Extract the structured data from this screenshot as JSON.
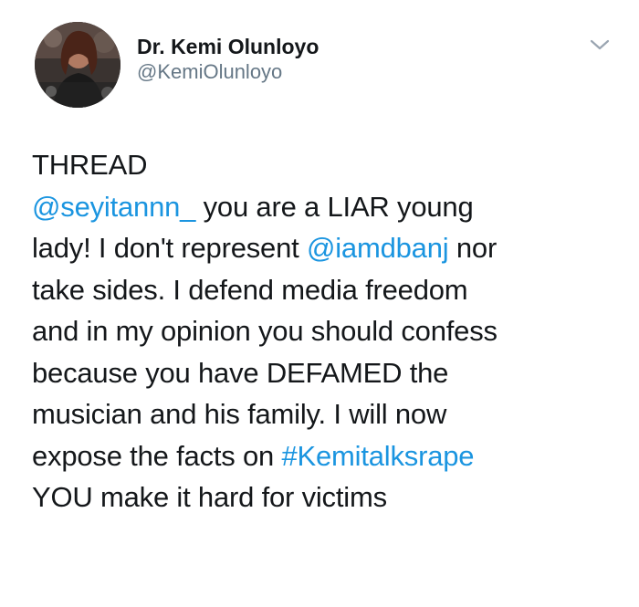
{
  "author": {
    "display_name": "Dr. Kemi Olunloyo",
    "handle": "@KemiOlunloyo"
  },
  "colors": {
    "link": "#1b95e0",
    "text": "#14171a",
    "secondary": "#657786"
  },
  "tweet": {
    "line1": {
      "text": "THREAD"
    },
    "line2": {
      "mention": "@seyitannn_",
      "text": " you are a  LIAR young"
    },
    "line3": {
      "text": "lady! I don't represent ",
      "mention": "@iamdbanj",
      "text2": " nor"
    },
    "line4": {
      "text": "take sides. I defend media freedom"
    },
    "line5": {
      "text": "and in my opinion you should confess"
    },
    "line6": {
      "text": "because you have DEFAMED the"
    },
    "line7": {
      "text": "musician and his family. I will now"
    },
    "line8": {
      "text": "expose the facts on ",
      "hashtag": "#Kemitalksrape"
    },
    "line9": {
      "text": "YOU make it hard for victims"
    }
  },
  "icons": {
    "menu": "chevron-down-icon"
  }
}
